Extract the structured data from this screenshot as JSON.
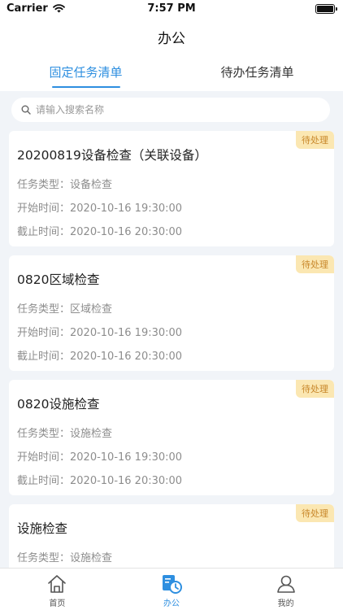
{
  "status": {
    "carrier": "Carrier",
    "time": "7:57 PM",
    "battery_level": 1.0
  },
  "nav": {
    "title": "办公"
  },
  "tabs": [
    {
      "label": "固定任务清单",
      "active": true
    },
    {
      "label": "待办任务清单",
      "active": false
    }
  ],
  "search": {
    "placeholder": "请输入搜索名称",
    "value": ""
  },
  "tasks": [
    {
      "status": "待处理",
      "title": "20200819设备检查（关联设备）",
      "type": "任务类型：设备检查",
      "start": "开始时间：2020-10-16 19:30:00",
      "end": "截止时间：2020-10-16 20:30:00"
    },
    {
      "status": "待处理",
      "title": "0820区域检查",
      "type": "任务类型：区域检查",
      "start": "开始时间：2020-10-16 19:30:00",
      "end": "截止时间：2020-10-16 20:30:00"
    },
    {
      "status": "待处理",
      "title": "0820设施检查",
      "type": "任务类型：设施检查",
      "start": "开始时间：2020-10-16 19:30:00",
      "end": "截止时间：2020-10-16 20:30:00"
    },
    {
      "status": "待处理",
      "title": "设施检查",
      "type": "任务类型：设施检查",
      "start": "",
      "end": ""
    }
  ],
  "tabbar": [
    {
      "label": "首页",
      "icon": "home-icon",
      "active": false
    },
    {
      "label": "办公",
      "icon": "office-clock-icon",
      "active": true
    },
    {
      "label": "我的",
      "icon": "user-icon",
      "active": false
    }
  ],
  "colors": {
    "accent": "#2e8fe0",
    "badge_bg": "#fbe7b2",
    "badge_text": "#c8872a",
    "page_bg": "#f1f4f8"
  }
}
